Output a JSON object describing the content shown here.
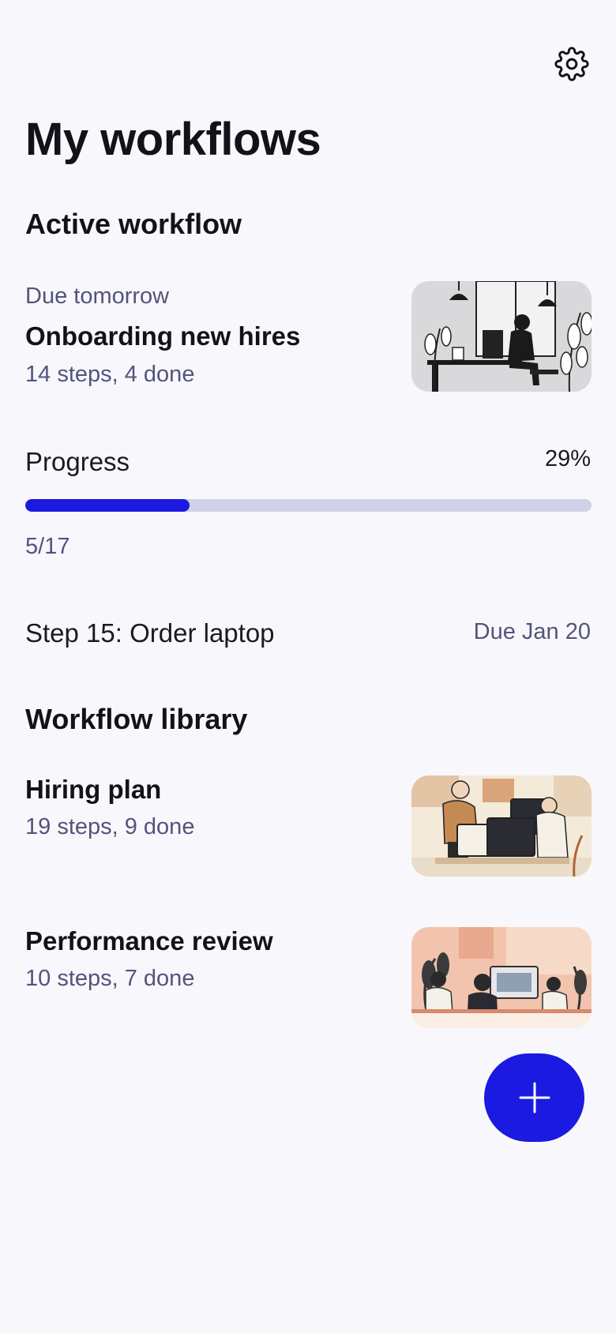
{
  "header": {
    "title": "My workflows",
    "settings_icon": "gear-icon"
  },
  "active": {
    "section_title": "Active workflow",
    "due": "Due tomorrow",
    "name": "Onboarding new hires",
    "summary": "14 steps, 4 done",
    "progress_label": "Progress",
    "progress_percent": "29%",
    "progress_value": 0.29,
    "progress_fraction": "5/17",
    "step_label": "Step 15: Order laptop",
    "step_due": "Due Jan 20"
  },
  "library": {
    "section_title": "Workflow library",
    "items": [
      {
        "name": "Hiring plan",
        "summary": "19 steps, 9 done"
      },
      {
        "name": "Performance review",
        "summary": "10 steps, 7 done"
      }
    ]
  },
  "fab": {
    "icon": "plus-icon"
  },
  "colors": {
    "accent": "#1a1ae0",
    "track": "#cfd1e6",
    "muted_text": "#53537c",
    "background": "#f8f8fc"
  }
}
